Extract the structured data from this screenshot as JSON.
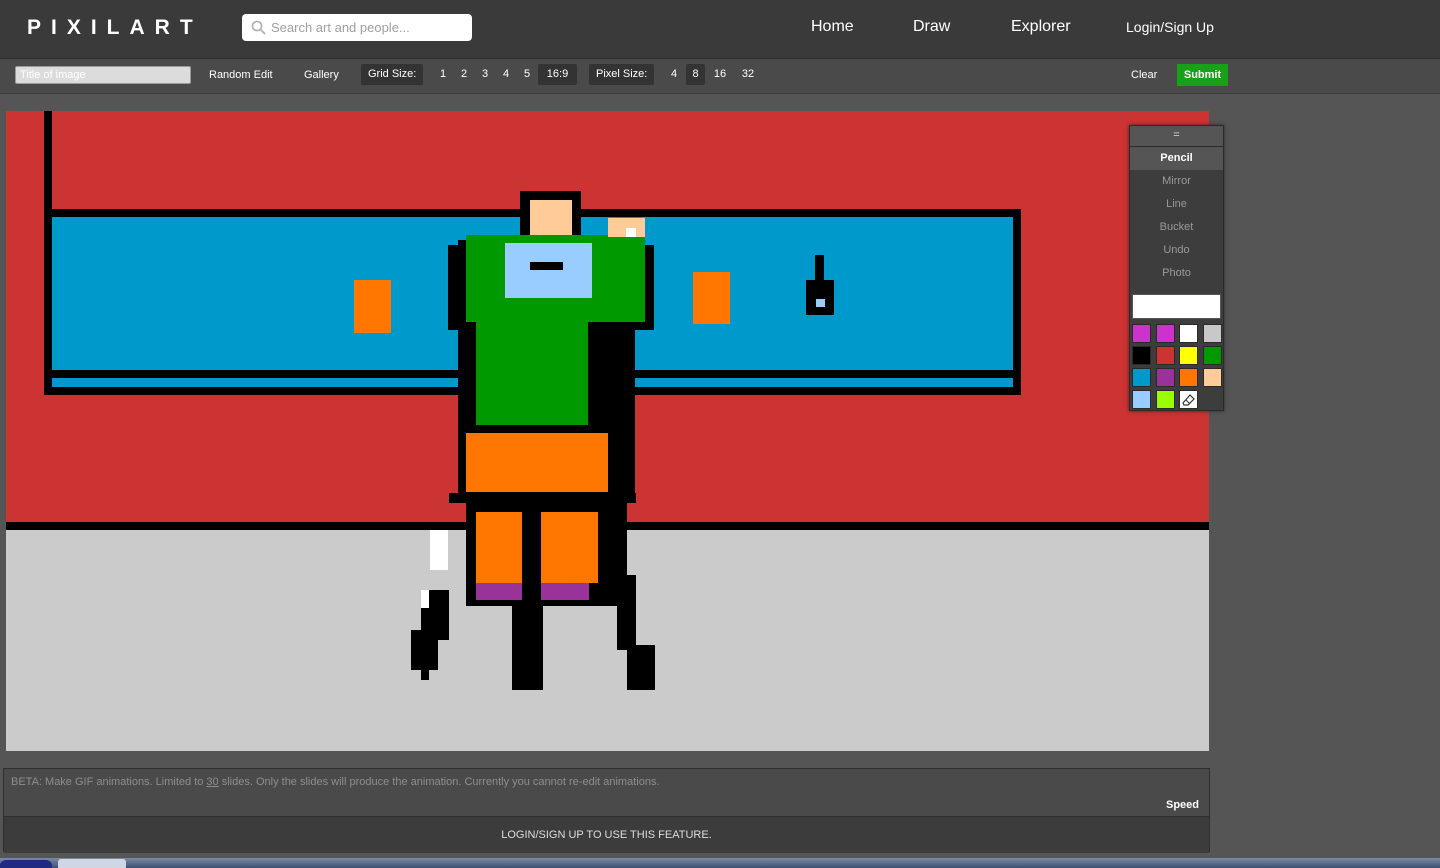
{
  "header": {
    "logo": "PIXILART",
    "search_placeholder": "Search art and people...",
    "nav": [
      {
        "label": "Home"
      },
      {
        "label": "Draw"
      },
      {
        "label": "Explorer"
      },
      {
        "label": "Login/Sign Up"
      }
    ]
  },
  "toolbar": {
    "title_placeholder": "Title of image",
    "random_edit": "Random Edit",
    "gallery": "Gallery",
    "grid_size_label": "Grid Size:",
    "grid_sizes": [
      "1",
      "2",
      "3",
      "4",
      "5",
      "16:9"
    ],
    "grid_size_selected": "16:9",
    "pixel_size_label": "Pixel Size:",
    "pixel_sizes": [
      "4",
      "8",
      "16",
      "32"
    ],
    "pixel_size_selected": "8",
    "clear": "Clear",
    "submit": "Submit"
  },
  "tools": {
    "handle": "=",
    "items": [
      "Pencil",
      "Mirror",
      "Line",
      "Bucket",
      "Undo",
      "Photo"
    ],
    "active": "Pencil",
    "current_color": "#ffffff",
    "palette": [
      "#cc33cc",
      "#cc33cc",
      "#ffffff",
      "#c8c8c8",
      "#000000",
      "#cc3333",
      "#ffff00",
      "#009900",
      "#0099cc",
      "#993399",
      "#ff7700",
      "#ffcc99",
      "#99ccff",
      "#99ff00",
      "eraser-icon"
    ]
  },
  "canvas": {
    "colors": {
      "wall": "#cc3333",
      "floor": "#cbcbcb",
      "window": "#0099cc",
      "outline": "#000000",
      "shirt": "#009900",
      "skirt": "#ff7700",
      "skin": "#ffcc99",
      "collar": "#99ccff",
      "shoes": "#993399",
      "highlight": "#ffffff"
    }
  },
  "animation": {
    "beta_prefix": "BETA: Make GIF animations. Limited to ",
    "beta_limit": "30",
    "beta_suffix": " slides. Only the slides will produce the animation. Currently you cannot re-edit animations.",
    "speed_label": "Speed",
    "login_notice": "LOGIN/SIGN UP TO USE THIS FEATURE."
  }
}
